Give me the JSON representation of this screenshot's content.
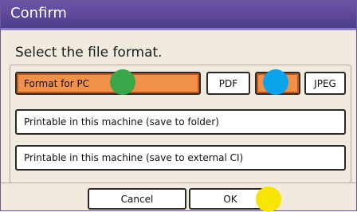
{
  "dialog": {
    "title": "Confirm",
    "prompt": "Select the file format."
  },
  "formats": {
    "pc_label": "Format for PC",
    "pdf_label": "PDF",
    "third_label": "",
    "jpeg_label": "JPEG"
  },
  "options": [
    {
      "label": "Printable in this machine (save to folder)"
    },
    {
      "label": "Printable in this machine (save to external CI)"
    }
  ],
  "footer": {
    "cancel_label": "Cancel",
    "ok_label": "OK"
  },
  "colors": {
    "title_bar": "#5a46a0",
    "selected": "#f2914b",
    "dialog_bg": "#f1eadf",
    "marker_green": "#3aa64a",
    "marker_blue": "#0aa3ea",
    "marker_yellow": "#f7e400"
  }
}
